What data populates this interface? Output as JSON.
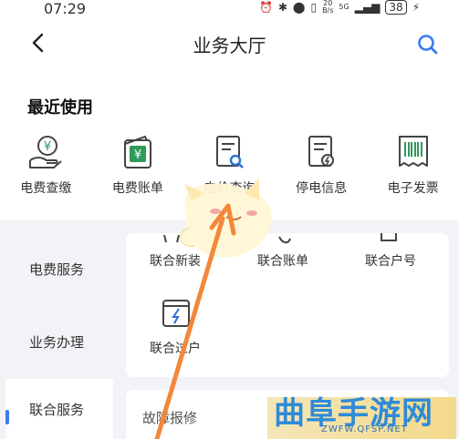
{
  "status_bar": {
    "time": "07:29",
    "network_speed_top": "20",
    "network_speed_unit": "B/s",
    "network_type": "5G",
    "battery": "38"
  },
  "header": {
    "title": "业务大厅"
  },
  "recent": {
    "title": "最近使用",
    "items": [
      {
        "label": "电费查缴",
        "icon": "yuan-hand-icon"
      },
      {
        "label": "电费账单",
        "icon": "yuan-wallet-icon"
      },
      {
        "label": "电价查询",
        "icon": "doc-search-icon"
      },
      {
        "label": "停电信息",
        "icon": "doc-power-icon"
      },
      {
        "label": "电子发票",
        "icon": "barcode-invoice-icon"
      }
    ]
  },
  "sidebar": {
    "items": [
      {
        "label": "电费服务"
      },
      {
        "label": "业务办理"
      },
      {
        "label": "联合服务",
        "active": true
      }
    ]
  },
  "joint_services": {
    "items": [
      {
        "label": "联合新装"
      },
      {
        "label": "联合账单"
      },
      {
        "label": "联合户号"
      },
      {
        "label": "联合过户"
      }
    ]
  },
  "fault": {
    "title": "故障报修"
  },
  "watermark": {
    "text": "曲阜手游网",
    "url": "ZWFW.QFSP.NET"
  },
  "colors": {
    "accent": "#3a7bf0",
    "icon_stroke": "#444444",
    "icon_green": "#2f9a5a"
  }
}
